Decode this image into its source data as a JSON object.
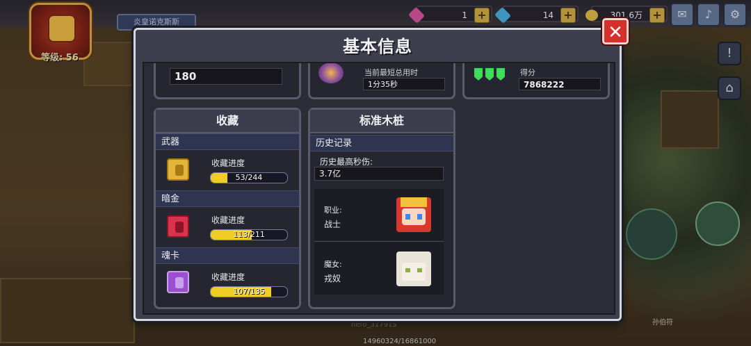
{
  "hud": {
    "level_label": "等级: 56",
    "player_name": "炎皇诺克斯斯",
    "resource1_value": "1",
    "resource2_value": "14",
    "gold_value": "301.6万",
    "plus_label": "+",
    "npc_caption": "hero_31791S",
    "exp_text": "14960324/16861000",
    "right_caption": "孙伯符"
  },
  "modal": {
    "title": "基本信息",
    "close_label": "✕"
  },
  "top_cards": {
    "left_value": "180",
    "middle_label": "当前最短总用时",
    "middle_value": "1分35秒",
    "right_label": "得分",
    "right_value": "7868222"
  },
  "collection": {
    "title": "收藏",
    "progress_label": "收藏进度",
    "items": [
      {
        "name": "武器",
        "current": 53,
        "total": 244,
        "text": "53/244",
        "icon_color": "#e3b53b",
        "icon_inner": "#a77a12"
      },
      {
        "name": "暗金",
        "current": 113,
        "total": 211,
        "text": "113/211",
        "icon_color": "#d9344b",
        "icon_inner": "#8c1628"
      },
      {
        "name": "魂卡",
        "current": 107,
        "total": 135,
        "text": "107/135",
        "icon_color": "#9b4ed0",
        "icon_inner": "#c9a2ee"
      }
    ]
  },
  "training": {
    "title": "标准木桩",
    "history_label": "历史记录",
    "max_dps_label": "历史最高秒伤:",
    "max_dps_value": "3.7亿",
    "class_label": "职业:",
    "class_value": "战士",
    "witch_label": "魔女:",
    "witch_value": "戎奴"
  },
  "colors": {
    "progress_fill": "#f0cd24",
    "close_button": "#d5302b",
    "section_bar": "#2f3550"
  }
}
